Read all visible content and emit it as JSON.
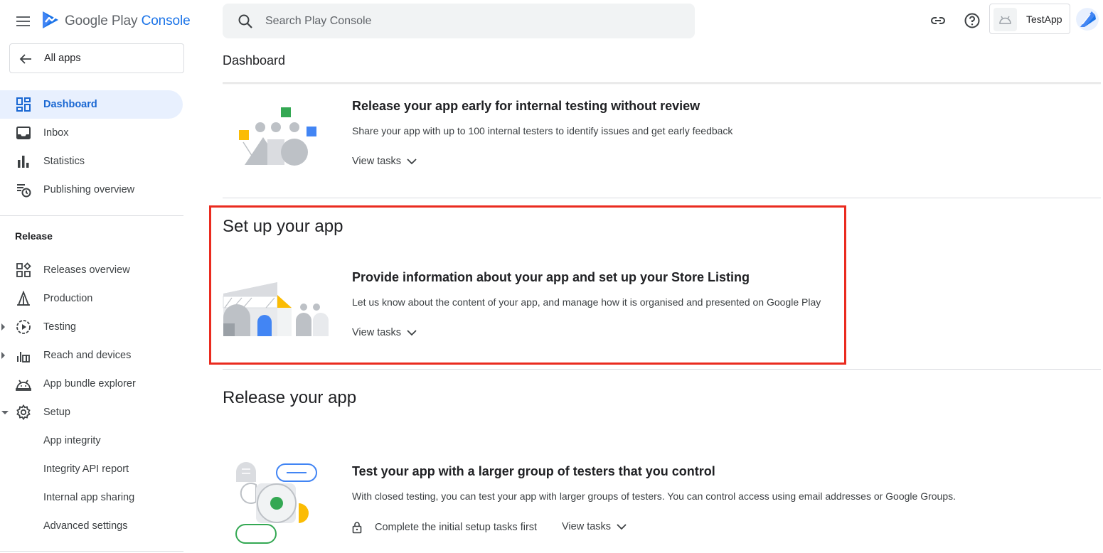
{
  "brand": {
    "name_part1": "Google Play ",
    "name_part2": "Console"
  },
  "sidebar": {
    "back_label": "All apps",
    "items": [
      {
        "label": "Dashboard",
        "icon": "dashboard-icon",
        "active": true
      },
      {
        "label": "Inbox",
        "icon": "inbox-icon"
      },
      {
        "label": "Statistics",
        "icon": "bar-chart-icon"
      },
      {
        "label": "Publishing overview",
        "icon": "publishing-overview-icon"
      }
    ],
    "release_section": "Release",
    "release_items": [
      {
        "label": "Releases overview",
        "icon": "releases-overview-icon"
      },
      {
        "label": "Production",
        "icon": "production-icon"
      },
      {
        "label": "Testing",
        "icon": "testing-icon",
        "expandable": "collapsed"
      },
      {
        "label": "Reach and devices",
        "icon": "reach-devices-icon",
        "expandable": "collapsed"
      },
      {
        "label": "App bundle explorer",
        "icon": "android-icon"
      },
      {
        "label": "Setup",
        "icon": "gear-icon",
        "expandable": "expanded"
      },
      {
        "label": "App integrity"
      },
      {
        "label": "Integrity API report"
      },
      {
        "label": "Internal app sharing"
      },
      {
        "label": "Advanced settings"
      }
    ]
  },
  "search": {
    "placeholder": "Search Play Console"
  },
  "topbar": {
    "app_name": "TestApp"
  },
  "page_title": "Dashboard",
  "cards": {
    "internal": {
      "title": "Release your app early for internal testing without review",
      "desc": "Share your app with up to 100 internal testers to identify issues and get early feedback",
      "view_tasks": "View tasks"
    },
    "setup_section": "Set up your app",
    "setup": {
      "title": "Provide information about your app and set up your Store Listing",
      "desc": "Let us know about the content of your app, and manage how it is organised and presented on Google Play",
      "view_tasks": "View tasks"
    },
    "release_section": "Release your app",
    "closed": {
      "title": "Test your app with a larger group of testers that you control",
      "desc": "With closed testing, you can test your app with larger groups of testers. You can control access using email addresses or Google Groups.",
      "locked_text": "Complete the initial setup tasks first",
      "view_tasks": "View tasks"
    }
  },
  "colors": {
    "accent": "#1a73e8",
    "active_bg": "#e8f0fe",
    "highlight": "#ea2b1f"
  }
}
